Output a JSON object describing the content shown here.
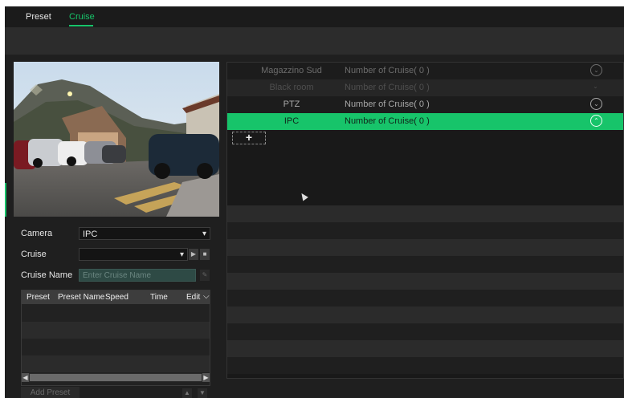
{
  "tabs": [
    {
      "label": "Preset",
      "active": false
    },
    {
      "label": "Cruise",
      "active": true
    }
  ],
  "form": {
    "camera_label": "Camera",
    "camera_value": "IPC",
    "cruise_label": "Cruise",
    "cruise_value": "",
    "cruise_name_label": "Cruise Name",
    "cruise_name_placeholder": "Enter Cruise Name"
  },
  "preset_table": {
    "columns": [
      "Preset",
      "Preset Name",
      "Speed",
      "Time",
      "Edit"
    ],
    "rows": []
  },
  "buttons": {
    "add_preset": "Add Preset"
  },
  "camera_list": [
    {
      "name": "Magazzino Sud",
      "cruise": "Number of Cruise( 0 )",
      "state": "dim",
      "icon": "chevron-down-circle-icon"
    },
    {
      "name": "Black room",
      "cruise": "Number of Cruise( 0 )",
      "state": "dimmer",
      "icon": "chevron-down-icon"
    },
    {
      "name": "PTZ",
      "cruise": "Number of Cruise( 0 )",
      "state": "normal",
      "icon": "chevron-down-circle-icon"
    },
    {
      "name": "IPC",
      "cruise": "Number of Cruise( 0 )",
      "state": "selected",
      "icon": "chevron-up-circle-icon"
    }
  ],
  "add_cruise_symbol": "+",
  "colors": {
    "accent": "#17c46a",
    "background": "#1f1f1f",
    "panel": "#191919"
  }
}
